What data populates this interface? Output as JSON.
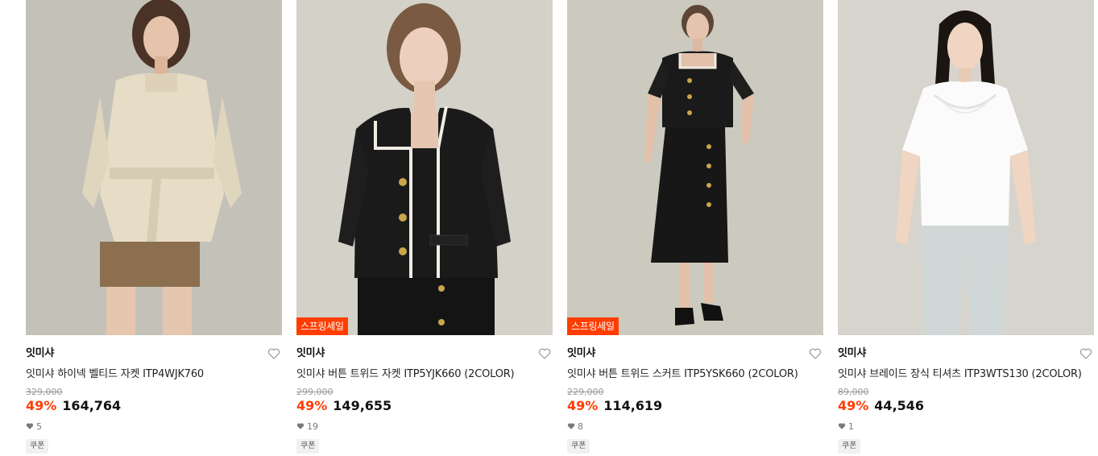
{
  "products": [
    {
      "brand": "잇미샤",
      "name": "잇미샤 하이넥 벨티드 자켓 ITP4WJK760",
      "original_price": "329,000",
      "discount": "49%",
      "price": "164,764",
      "likes": "5",
      "coupon": "쿠폰",
      "sale_tag": ""
    },
    {
      "brand": "잇미샤",
      "name": "잇미샤 버튼 트위드 자켓 ITP5YJK660 (2COLOR)",
      "original_price": "299,000",
      "discount": "49%",
      "price": "149,655",
      "likes": "19",
      "coupon": "쿠폰",
      "sale_tag": "스프링세일"
    },
    {
      "brand": "잇미샤",
      "name": "잇미샤 버튼 트위드 스커트 ITP5YSK660 (2COLOR)",
      "original_price": "229,000",
      "discount": "49%",
      "price": "114,619",
      "likes": "8",
      "coupon": "쿠폰",
      "sale_tag": "스프링세일"
    },
    {
      "brand": "잇미샤",
      "name": "잇미샤 브레이드 장식 티셔츠 ITP3WTS130 (2COLOR)",
      "original_price": "89,000",
      "discount": "49%",
      "price": "44,546",
      "likes": "1",
      "coupon": "쿠폰",
      "sale_tag": ""
    }
  ],
  "colors": {
    "discount": "#ff3d00",
    "sale_tag_bg": "#ff3d00",
    "original_price": "#9a9a9a"
  },
  "icons": {
    "wishlist": "heart-outline-icon",
    "likes": "heart-filled-icon"
  }
}
